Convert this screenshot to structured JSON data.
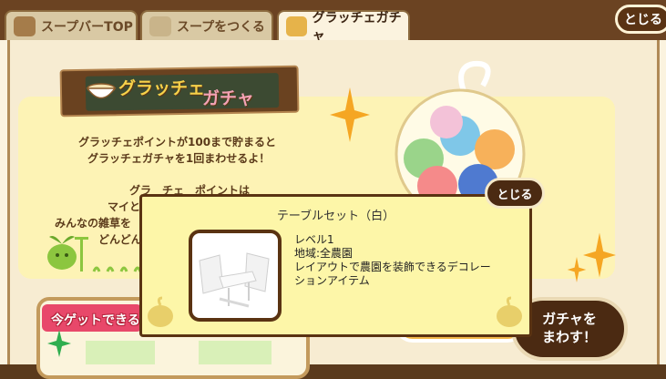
{
  "tabs": [
    {
      "label": "スープバーTOP",
      "icon": "soup-bar-icon"
    },
    {
      "label": "スープをつくる",
      "icon": "soup-bowl-icon"
    },
    {
      "label": "グラッチェガチャ",
      "icon": "gacha-icon",
      "active": true
    }
  ],
  "close_label": "とじる",
  "banner": {
    "title_part1": "グラッチェ",
    "title_part2": "ガチャ"
  },
  "description": {
    "line1": "グラッチェポイントが100まで貯まると",
    "line2": "グラッチェガチャを1回まわせるよ！",
    "partial_line1": "グラ　チェ　ポイントは",
    "partial_line2": "マイと",
    "partial_line3": "みんなの雑草を",
    "partial_line4": "どんどん"
  },
  "lower_section": {
    "label": "今ゲットできる"
  },
  "spin_button": {
    "line1": "ガチャを",
    "line2": "まわす！"
  },
  "popup": {
    "title": "テーブルセット（白）",
    "level": "レベル1",
    "region": "地域:全農園",
    "description": "レイアウトで農園を装飾できるデコレーションアイテム",
    "close_label": "とじる"
  },
  "colors": {
    "frame_brown": "#6b4322",
    "panel_yellow": "#fdf3b5",
    "popup_yellow": "#fdf6a8",
    "accent_orange": "#f5a623"
  }
}
